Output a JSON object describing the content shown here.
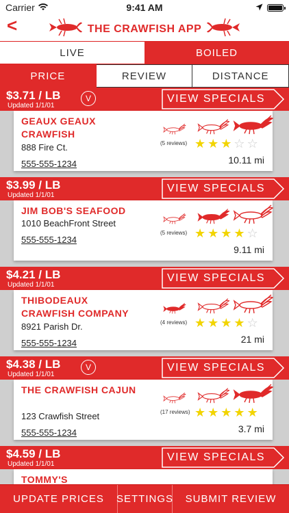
{
  "status_bar": {
    "carrier": "Carrier",
    "time": "9:41 AM"
  },
  "header": {
    "back_label": "<",
    "title": "THE CRAWFISH APP"
  },
  "tabs": [
    {
      "label": "LIVE",
      "active": true
    },
    {
      "label": "BOILED",
      "active": false
    }
  ],
  "sort_options": [
    {
      "label": "PRICE",
      "active": true
    },
    {
      "label": "REVIEW",
      "active": false
    },
    {
      "label": "DISTANCE",
      "active": false
    }
  ],
  "view_specials_label": "VIEW SPECIALS",
  "verified_badge": "V",
  "listings": [
    {
      "price": "$3.71 / LB",
      "updated": "Updated 1/1/01",
      "verified": true,
      "name": "GEAUX GEAUX CRAWFISH",
      "address": "888 Fire Ct.",
      "phone": "555-555-1234",
      "reviews": "(5 reviews)",
      "rating": 3,
      "distance": "10.11 mi",
      "price_level": 3
    },
    {
      "price": "$3.99 / LB",
      "updated": "Updated 1/1/01",
      "verified": false,
      "name": "JIM BOB'S SEAFOOD",
      "address": "1010 BeachFront Street",
      "phone": "555-555-1234",
      "reviews": "(5 reviews)",
      "rating": 4,
      "distance": "9.11 mi",
      "price_level": 2
    },
    {
      "price": "$4.21 / LB",
      "updated": "Updated 1/1/01",
      "verified": false,
      "name": "THIBODEAUX CRAWFISH COMPANY",
      "address": "8921 Parish Dr.",
      "phone": "555-555-1234",
      "reviews": "(4 reviews)",
      "rating": 4,
      "distance": "21 mi",
      "price_level": 1
    },
    {
      "price": "$4.38 / LB",
      "updated": "Updated 1/1/01",
      "verified": true,
      "name": "THE CRAWFISH CAJUN",
      "address": "123 Crawfish Street",
      "phone": "555-555-1234",
      "reviews": "(17 reviews)",
      "rating": 5,
      "distance": "3.7 mi",
      "price_level": 3
    },
    {
      "price": "$4.59 / LB",
      "updated": "Updated 1/1/01",
      "verified": false,
      "name": "TOMMY'S",
      "address": "",
      "phone": "",
      "reviews": "",
      "rating": 0,
      "distance": "",
      "price_level": 0
    }
  ],
  "bottom_nav": [
    {
      "label": "UPDATE PRICES"
    },
    {
      "label": "SETTINGS"
    },
    {
      "label": "SUBMIT REVIEW"
    }
  ],
  "colors": {
    "accent": "#e02a2a",
    "star": "#f2d400",
    "list_bg": "#cfcfcf"
  }
}
